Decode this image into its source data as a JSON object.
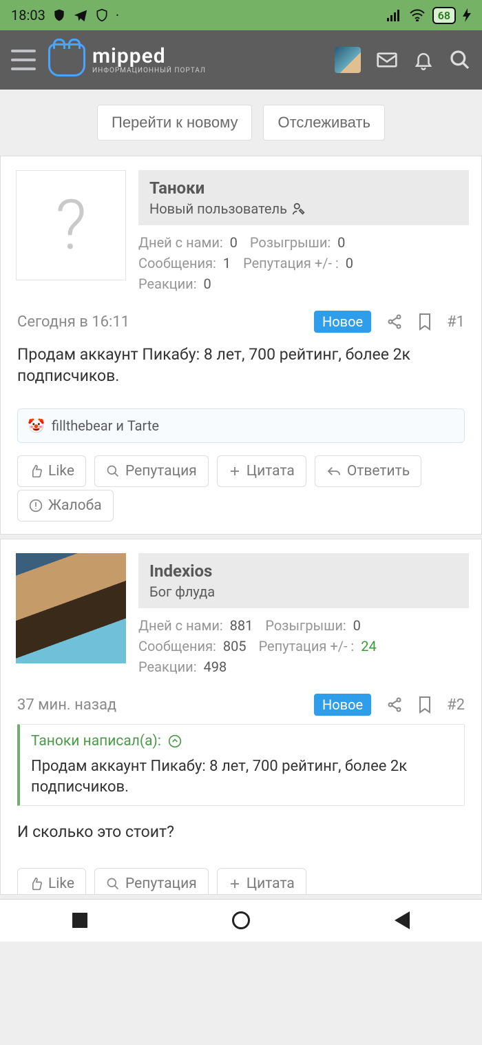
{
  "status": {
    "time": "18:03",
    "battery": "68"
  },
  "brand": {
    "name": "mipped",
    "sub": "информационный портал"
  },
  "topActions": {
    "gotoNew": "Перейти к новому",
    "follow": "Отслеживать"
  },
  "labels": {
    "days": "Дней с нами:",
    "raffles": "Розыгрыши:",
    "messages": "Сообщения:",
    "reputation": "Репутация +/- :",
    "reactions": "Реакции:",
    "new": "Новое",
    "like": "Like",
    "rep": "Репутация",
    "quote": "Цитата",
    "reply": "Ответить",
    "report": "Жалоба",
    "quoteSuffix": "написал(а):"
  },
  "posts": [
    {
      "user": {
        "name": "Таноки",
        "rank": "Новый пользователь",
        "avatarType": "q"
      },
      "stats": {
        "days": "0",
        "raffles": "0",
        "messages": "1",
        "reputation": "0",
        "reactions": "0",
        "repGreen": false
      },
      "time": "Сегодня в 16:11",
      "num": "#1",
      "body": "Продам аккаунт Пикабу: 8 лет, 700 рейтинг, более 2к подписчиков.",
      "reactors": "fillthebear и Tarte",
      "hasReactions": true,
      "fullActions": true
    },
    {
      "user": {
        "name": "Indexios",
        "rank": "Бог флуда",
        "avatarType": "img"
      },
      "stats": {
        "days": "881",
        "raffles": "0",
        "messages": "805",
        "reputation": "24",
        "reactions": "498",
        "repGreen": true
      },
      "time": "37 мин. назад",
      "num": "#2",
      "quote": {
        "author": "Таноки",
        "text": "Продам аккаунт Пикабу: 8 лет, 700 рейтинг, более 2к подписчиков."
      },
      "body": "И сколько это стоит?",
      "hasReactions": false,
      "fullActions": false
    }
  ]
}
